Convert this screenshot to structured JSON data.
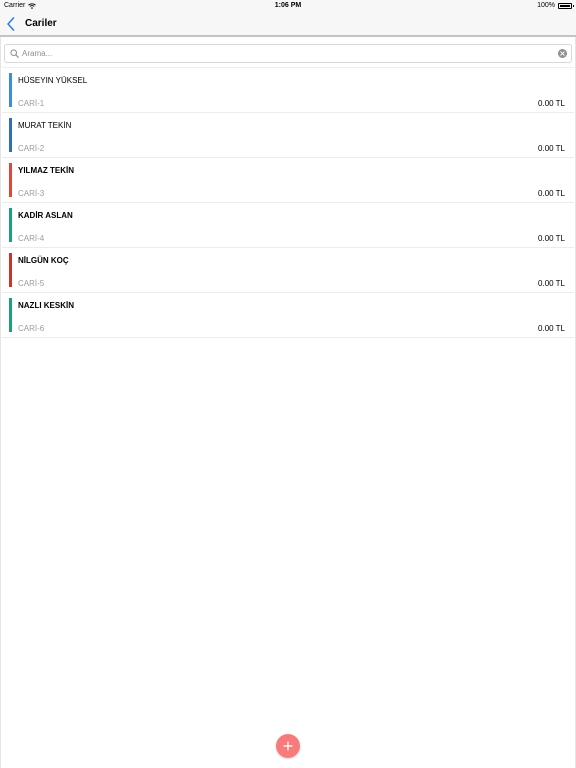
{
  "status_bar": {
    "carrier": "Carrier",
    "time": "1:06 PM",
    "battery_percent": "100%"
  },
  "nav": {
    "title": "Cariler"
  },
  "search": {
    "placeholder": "Arama...",
    "value": ""
  },
  "items": [
    {
      "name": "HÜSEYIN YÜKSEL",
      "code": "CARİ-1",
      "amount": "0.00 TL",
      "color": "#3a8fd4",
      "bold": false
    },
    {
      "name": "MURAT TEKİN",
      "code": "CARİ-2",
      "amount": "0.00 TL",
      "color": "#2f6fb6",
      "bold": false
    },
    {
      "name": "YILMAZ TEKİN",
      "code": "CARİ-3",
      "amount": "0.00 TL",
      "color": "#e0473a",
      "bold": true
    },
    {
      "name": "KADİR ASLAN",
      "code": "CARİ-4",
      "amount": "0.00 TL",
      "color": "#1aa07d",
      "bold": true
    },
    {
      "name": "NİLGÜN KOÇ",
      "code": "CARİ-5",
      "amount": "0.00 TL",
      "color": "#c9342b",
      "bold": true
    },
    {
      "name": "NAZLI KESKİN",
      "code": "CARİ-6",
      "amount": "0.00 TL",
      "color": "#1aa07d",
      "bold": true
    }
  ],
  "icons": {
    "back": "chevron-left-icon",
    "search": "search-icon",
    "clear": "clear-icon",
    "add": "plus-icon",
    "wifi": "wifi-icon",
    "battery": "battery-icon"
  },
  "colors": {
    "accent": "#2f7ee6",
    "fab": "#f87b7b"
  }
}
